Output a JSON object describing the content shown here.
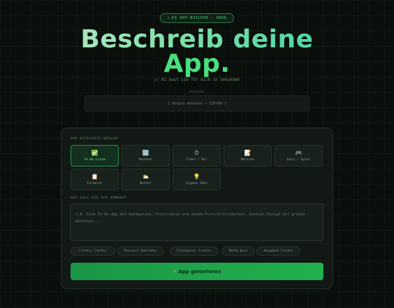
{
  "badge": {
    "icon": "sparkle-icon",
    "dot": "✦",
    "label": "KI APP-BUILDER · GROQ"
  },
  "hero": {
    "line1": "Beschreib deine",
    "line2": "App."
  },
  "subtitle": "// KI baut sie für dich in Sekunden",
  "ad": {
    "label": "WERBUNG",
    "text": "[ Google AdSense – 728×90 ]"
  },
  "categories_section": {
    "label": "APP-KATEGORIE WÄHLEN",
    "items": [
      {
        "icon": "check-icon",
        "glyph": "✅",
        "label": "To-Do Liste",
        "selected": true
      },
      {
        "icon": "calculator-icon",
        "glyph": "🔢",
        "label": "Rechner",
        "selected": false
      },
      {
        "icon": "timer-icon",
        "glyph": "⏱",
        "label": "Timer / Uhr",
        "selected": false
      },
      {
        "icon": "notes-icon",
        "glyph": "📝",
        "label": "Notizen",
        "selected": false
      },
      {
        "icon": "gamepad-icon",
        "glyph": "🎮",
        "label": "Quiz / Spiel",
        "selected": false
      },
      {
        "icon": "form-icon",
        "glyph": "📋",
        "label": "Formular",
        "selected": false
      },
      {
        "icon": "weather-icon",
        "glyph": "⛅",
        "label": "Wetter",
        "selected": false
      },
      {
        "icon": "lightbulb-icon",
        "glyph": "💡",
        "label": "Eigene Idee",
        "selected": false
      }
    ]
  },
  "prompt_section": {
    "label": "WAS SOLL DIE APP KÖNNEN?",
    "placeholder": "z.B. Eine To-Do App mit Kategorien, Prioritäten und einem Fortschrittsbalken. Dunkles Design mit grünen Akzenten..."
  },
  "suggestions": [
    "Fitness Tracker",
    "Passwort Generator",
    "Trinkwasser Tracker",
    "Mathe Quiz",
    "Ausgaben Tracker"
  ],
  "generate_button": {
    "icon": "lightning-icon",
    "glyph": "⚡",
    "label": "App generieren"
  }
}
